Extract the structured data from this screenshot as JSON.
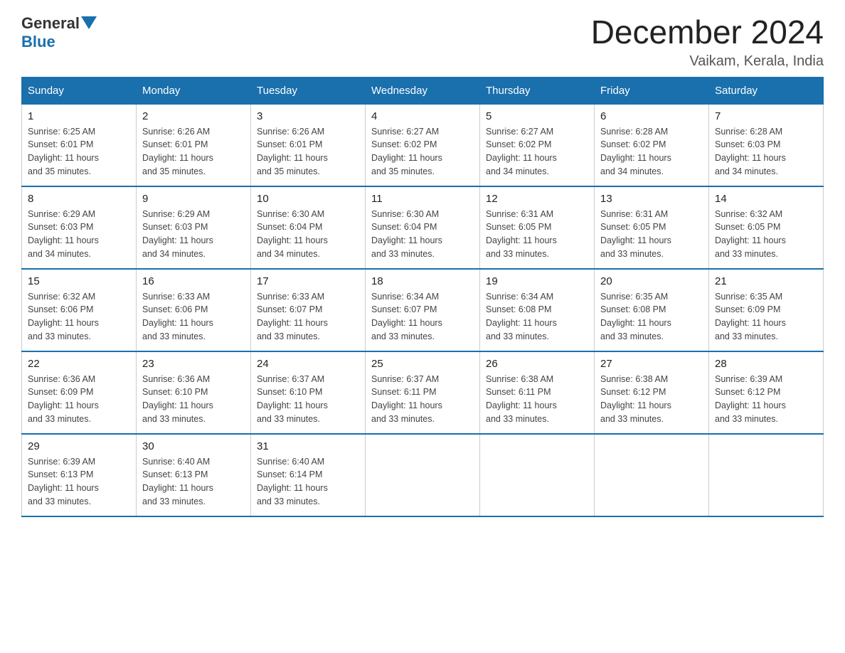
{
  "header": {
    "logo_general": "General",
    "logo_blue": "Blue",
    "month_title": "December 2024",
    "location": "Vaikam, Kerala, India"
  },
  "days_of_week": [
    "Sunday",
    "Monday",
    "Tuesday",
    "Wednesday",
    "Thursday",
    "Friday",
    "Saturday"
  ],
  "weeks": [
    [
      {
        "day": "1",
        "sunrise": "6:25 AM",
        "sunset": "6:01 PM",
        "daylight": "11 hours and 35 minutes."
      },
      {
        "day": "2",
        "sunrise": "6:26 AM",
        "sunset": "6:01 PM",
        "daylight": "11 hours and 35 minutes."
      },
      {
        "day": "3",
        "sunrise": "6:26 AM",
        "sunset": "6:01 PM",
        "daylight": "11 hours and 35 minutes."
      },
      {
        "day": "4",
        "sunrise": "6:27 AM",
        "sunset": "6:02 PM",
        "daylight": "11 hours and 35 minutes."
      },
      {
        "day": "5",
        "sunrise": "6:27 AM",
        "sunset": "6:02 PM",
        "daylight": "11 hours and 34 minutes."
      },
      {
        "day": "6",
        "sunrise": "6:28 AM",
        "sunset": "6:02 PM",
        "daylight": "11 hours and 34 minutes."
      },
      {
        "day": "7",
        "sunrise": "6:28 AM",
        "sunset": "6:03 PM",
        "daylight": "11 hours and 34 minutes."
      }
    ],
    [
      {
        "day": "8",
        "sunrise": "6:29 AM",
        "sunset": "6:03 PM",
        "daylight": "11 hours and 34 minutes."
      },
      {
        "day": "9",
        "sunrise": "6:29 AM",
        "sunset": "6:03 PM",
        "daylight": "11 hours and 34 minutes."
      },
      {
        "day": "10",
        "sunrise": "6:30 AM",
        "sunset": "6:04 PM",
        "daylight": "11 hours and 34 minutes."
      },
      {
        "day": "11",
        "sunrise": "6:30 AM",
        "sunset": "6:04 PM",
        "daylight": "11 hours and 33 minutes."
      },
      {
        "day": "12",
        "sunrise": "6:31 AM",
        "sunset": "6:05 PM",
        "daylight": "11 hours and 33 minutes."
      },
      {
        "day": "13",
        "sunrise": "6:31 AM",
        "sunset": "6:05 PM",
        "daylight": "11 hours and 33 minutes."
      },
      {
        "day": "14",
        "sunrise": "6:32 AM",
        "sunset": "6:05 PM",
        "daylight": "11 hours and 33 minutes."
      }
    ],
    [
      {
        "day": "15",
        "sunrise": "6:32 AM",
        "sunset": "6:06 PM",
        "daylight": "11 hours and 33 minutes."
      },
      {
        "day": "16",
        "sunrise": "6:33 AM",
        "sunset": "6:06 PM",
        "daylight": "11 hours and 33 minutes."
      },
      {
        "day": "17",
        "sunrise": "6:33 AM",
        "sunset": "6:07 PM",
        "daylight": "11 hours and 33 minutes."
      },
      {
        "day": "18",
        "sunrise": "6:34 AM",
        "sunset": "6:07 PM",
        "daylight": "11 hours and 33 minutes."
      },
      {
        "day": "19",
        "sunrise": "6:34 AM",
        "sunset": "6:08 PM",
        "daylight": "11 hours and 33 minutes."
      },
      {
        "day": "20",
        "sunrise": "6:35 AM",
        "sunset": "6:08 PM",
        "daylight": "11 hours and 33 minutes."
      },
      {
        "day": "21",
        "sunrise": "6:35 AM",
        "sunset": "6:09 PM",
        "daylight": "11 hours and 33 minutes."
      }
    ],
    [
      {
        "day": "22",
        "sunrise": "6:36 AM",
        "sunset": "6:09 PM",
        "daylight": "11 hours and 33 minutes."
      },
      {
        "day": "23",
        "sunrise": "6:36 AM",
        "sunset": "6:10 PM",
        "daylight": "11 hours and 33 minutes."
      },
      {
        "day": "24",
        "sunrise": "6:37 AM",
        "sunset": "6:10 PM",
        "daylight": "11 hours and 33 minutes."
      },
      {
        "day": "25",
        "sunrise": "6:37 AM",
        "sunset": "6:11 PM",
        "daylight": "11 hours and 33 minutes."
      },
      {
        "day": "26",
        "sunrise": "6:38 AM",
        "sunset": "6:11 PM",
        "daylight": "11 hours and 33 minutes."
      },
      {
        "day": "27",
        "sunrise": "6:38 AM",
        "sunset": "6:12 PM",
        "daylight": "11 hours and 33 minutes."
      },
      {
        "day": "28",
        "sunrise": "6:39 AM",
        "sunset": "6:12 PM",
        "daylight": "11 hours and 33 minutes."
      }
    ],
    [
      {
        "day": "29",
        "sunrise": "6:39 AM",
        "sunset": "6:13 PM",
        "daylight": "11 hours and 33 minutes."
      },
      {
        "day": "30",
        "sunrise": "6:40 AM",
        "sunset": "6:13 PM",
        "daylight": "11 hours and 33 minutes."
      },
      {
        "day": "31",
        "sunrise": "6:40 AM",
        "sunset": "6:14 PM",
        "daylight": "11 hours and 33 minutes."
      },
      null,
      null,
      null,
      null
    ]
  ],
  "labels": {
    "sunrise": "Sunrise:",
    "sunset": "Sunset:",
    "daylight": "Daylight:"
  }
}
